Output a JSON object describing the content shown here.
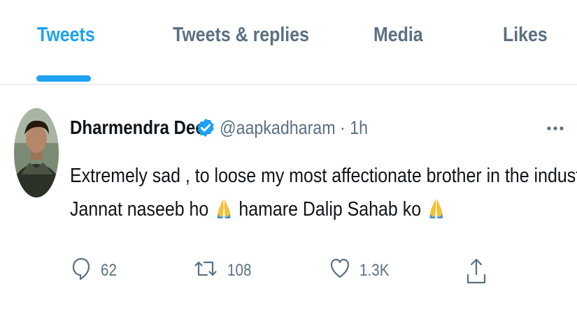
{
  "tabs": [
    {
      "label": "Tweets",
      "active": true
    },
    {
      "label": "Tweets & replies",
      "active": false
    },
    {
      "label": "Media",
      "active": false
    },
    {
      "label": "Likes",
      "active": false
    }
  ],
  "tweet": {
    "author_name": "Dharmendra Deol",
    "verified": true,
    "handle": "@aapkadharam",
    "separator": "·",
    "time": "1h",
    "more_icon": "more-horizontal-icon",
    "text_line1": "Extremely sad , to loose my most affectionate brother in the industry.",
    "text_line2a": "Jannat naseeb ho",
    "text_line2b": "hamare Dalip Sahab ko",
    "emoji": "folded-hands",
    "actions": {
      "reply_count": "62",
      "retweet_count": "108",
      "like_count": "1.3K",
      "share_icon": "share-icon"
    }
  },
  "colors": {
    "accent": "#1da1f2",
    "secondary_text": "#5b7083",
    "primary_text": "#0f1419",
    "divider": "#e9edf0"
  }
}
